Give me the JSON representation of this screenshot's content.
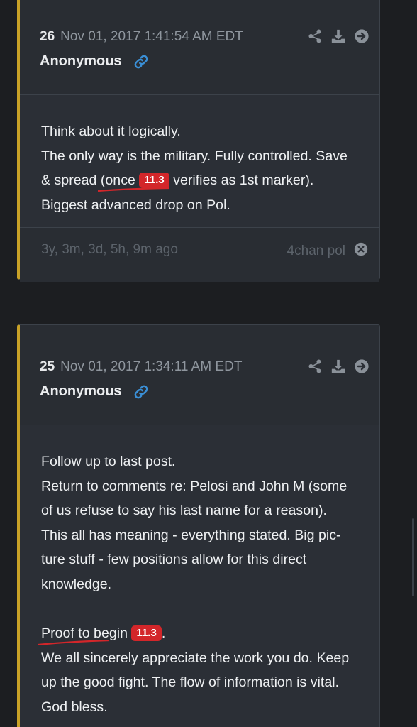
{
  "posts": [
    {
      "number": "26",
      "timestamp": "Nov 01, 2017 1:41:54 AM EDT",
      "author": "Anonymous",
      "body": {
        "line1": "Think about it logically.",
        "line2": "The only way is the military. Fully controlled. Save",
        "line3_before": "& spread ",
        "line3_hl_before": "(once ",
        "line3_badge": "11.3",
        "line3_hl_after": " verifies as 1st marker)",
        "line3_after": ".",
        "line4": "Biggest advanced drop on Pol."
      },
      "footer": {
        "ago": "3y, 3m, 3d, 5h, 9m ago",
        "source": "4chan pol"
      }
    },
    {
      "number": "25",
      "timestamp": "Nov 01, 2017 1:34:11 AM EDT",
      "author": "Anonymous",
      "body": {
        "line1": "Follow up to last post.",
        "line2": "Return to comments re: Pelosi and John M (some",
        "line3": "of us refuse to say his last name for a reason).",
        "line4": "This all has meaning - everything stated. Big pic-",
        "line5": "ture stuff - few positions allow for this direct",
        "line6": "knowledge.",
        "line8_hl": "Proof to begin ",
        "line8_badge": "11.3",
        "line8_after": ".",
        "line9": "We all sincerely appreciate the work you do. Keep",
        "line10": "up the good fight. The flow of information is vital.",
        "line11": "God bless."
      }
    }
  ],
  "icons": {
    "share": "share-icon",
    "download": "download-icon",
    "open": "arrow-right-circle-icon",
    "link": "link-icon",
    "close": "close-circle-icon"
  },
  "colors": {
    "background": "#1c1e21",
    "card": "#2b2f36",
    "accent_border": "#c9a227",
    "badge": "#d3262a",
    "link": "#3a8fd6"
  }
}
